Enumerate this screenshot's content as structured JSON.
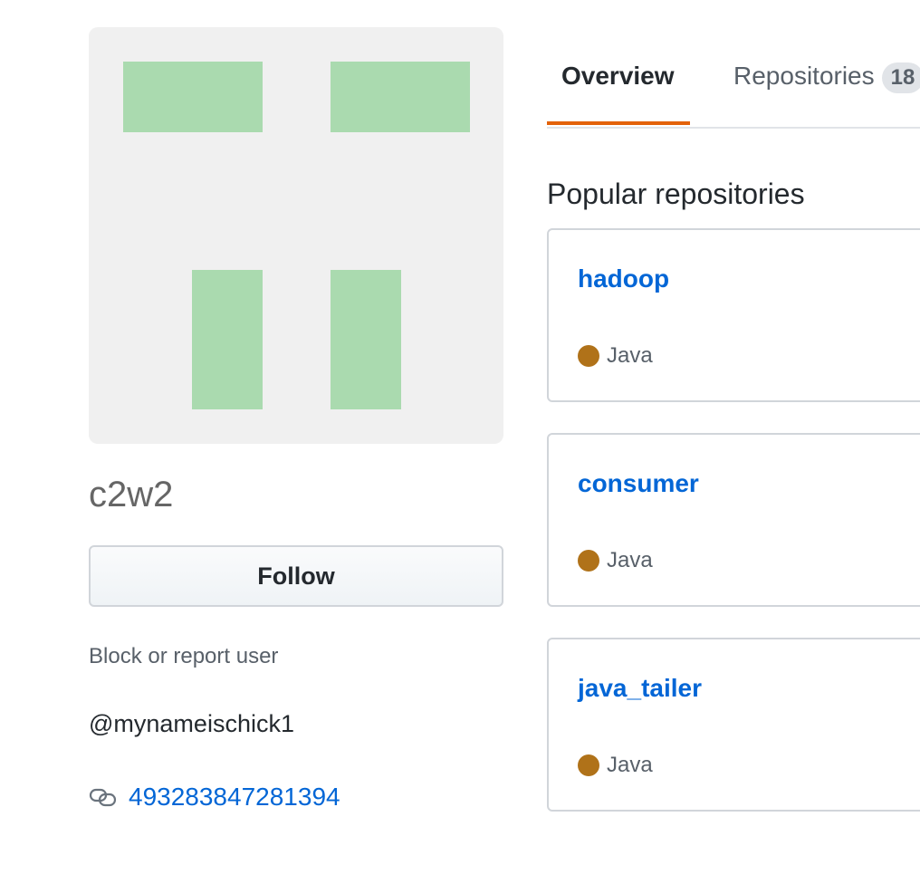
{
  "profile": {
    "display_name": "c2w2",
    "follow_label": "Follow",
    "block_label": "Block or report user",
    "username": "@mynameischick1",
    "website": "493283847281394"
  },
  "avatar_icon": "identicon",
  "tabs": [
    {
      "label": "Overview",
      "selected": true
    },
    {
      "label": "Repositories",
      "count": "18",
      "selected": false
    }
  ],
  "section_title": "Popular repositories",
  "repos": [
    {
      "name": "hadoop",
      "language": "Java",
      "language_color": "#b07219"
    },
    {
      "name": "consumer",
      "language": "Java",
      "language_color": "#b07219"
    },
    {
      "name": "java_tailer",
      "language": "Java",
      "language_color": "#b07219"
    }
  ],
  "colors": {
    "link": "#0366d6",
    "tab_accent": "#e36209",
    "identicon": "#aadaaf"
  }
}
